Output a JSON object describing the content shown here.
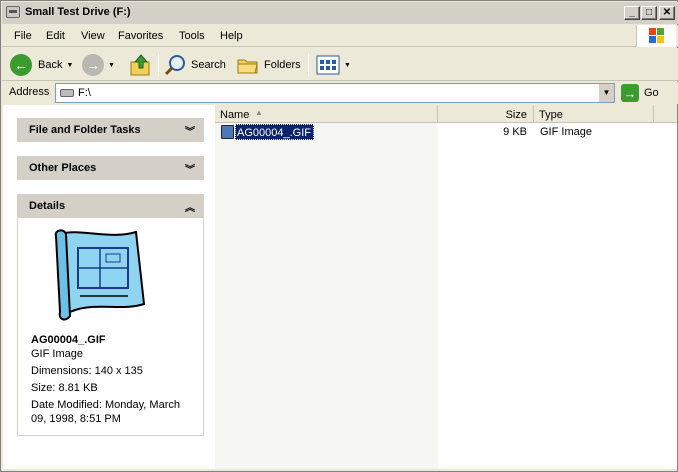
{
  "window": {
    "title": "Small Test Drive (F:)"
  },
  "menu": {
    "items": [
      "File",
      "Edit",
      "View",
      "Favorites",
      "Tools",
      "Help"
    ]
  },
  "toolbar": {
    "back_label": "Back",
    "search_label": "Search",
    "folders_label": "Folders"
  },
  "address": {
    "label": "Address",
    "value": "F:\\",
    "go_label": "Go"
  },
  "left_pane": {
    "file_tasks_title": "File and Folder Tasks",
    "other_places_title": "Other Places",
    "details_title": "Details",
    "details": {
      "name": "AG00004_.GIF",
      "type": "GIF Image",
      "dimensions": "Dimensions: 140 x 135",
      "size": "Size: 8.81 KB",
      "modified": "Date Modified: Monday, March 09, 1998, 8:51 PM"
    }
  },
  "list": {
    "columns": [
      "Name",
      "Size",
      "Type"
    ],
    "rows": [
      {
        "name": "AG00004_.GIF",
        "size": "9 KB",
        "type": "GIF Image"
      }
    ]
  },
  "colors": {
    "selection": "#0b246a",
    "go_green": "#3a9b2f"
  }
}
